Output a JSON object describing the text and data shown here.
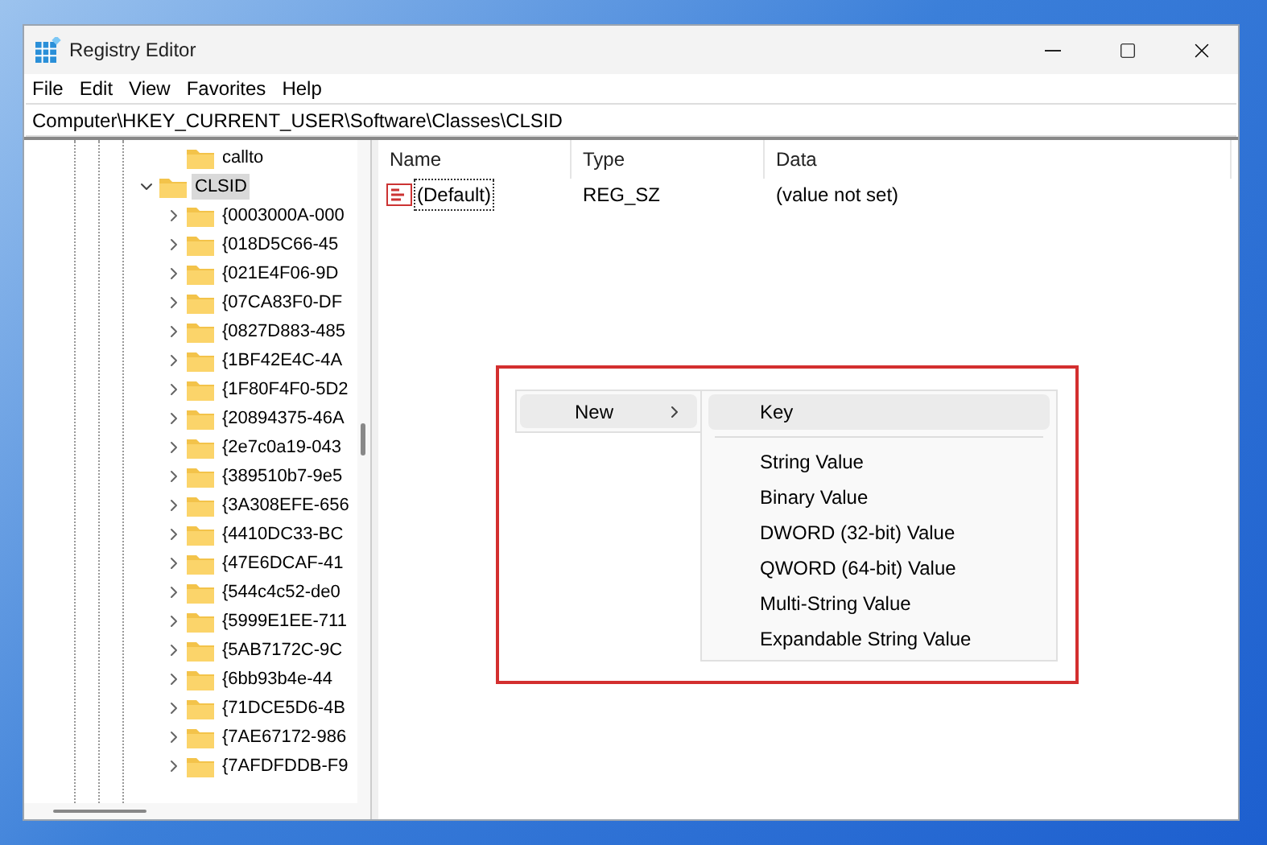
{
  "window": {
    "title": "Registry Editor"
  },
  "menu_bar": [
    "File",
    "Edit",
    "View",
    "Favorites",
    "Help"
  ],
  "address_bar": {
    "value": "Computer\\HKEY_CURRENT_USER\\Software\\Classes\\CLSID"
  },
  "tree": [
    {
      "label": "callto",
      "selected": false
    },
    {
      "label": "CLSID",
      "selected": true,
      "expanded": true,
      "children": [
        {
          "label": "{0003000A-000",
          "selected": false,
          "expanded": false
        },
        {
          "label": "{018D5C66-45",
          "selected": false,
          "expanded": false
        },
        {
          "label": "{021E4F06-9D",
          "selected": false,
          "expanded": false
        },
        {
          "label": "{07CA83F0-DF",
          "selected": false,
          "expanded": false
        },
        {
          "label": "{0827D883-485",
          "selected": false,
          "expanded": false
        },
        {
          "label": "{1BF42E4C-4A",
          "selected": false,
          "expanded": false
        },
        {
          "label": "{1F80F4F0-5D2",
          "selected": false,
          "expanded": false
        },
        {
          "label": "{20894375-46A",
          "selected": false,
          "expanded": false
        },
        {
          "label": "{2e7c0a19-043",
          "selected": false,
          "expanded": false
        },
        {
          "label": "{389510b7-9e5",
          "selected": false,
          "expanded": false
        },
        {
          "label": "{3A308EFE-656",
          "selected": false,
          "expanded": false
        },
        {
          "label": "{4410DC33-BC",
          "selected": false,
          "expanded": false
        },
        {
          "label": "{47E6DCAF-41",
          "selected": false,
          "expanded": false
        },
        {
          "label": "{544c4c52-de0",
          "selected": false,
          "expanded": false
        },
        {
          "label": "{5999E1EE-711",
          "selected": false,
          "expanded": false
        },
        {
          "label": "{5AB7172C-9C",
          "selected": false,
          "expanded": false
        },
        {
          "label": "{6bb93b4e-44",
          "selected": false,
          "expanded": false
        },
        {
          "label": "{71DCE5D6-4B",
          "selected": false,
          "expanded": false
        },
        {
          "label": "{7AE67172-986",
          "selected": false,
          "expanded": false
        },
        {
          "label": "{7AFDFDDB-F9",
          "selected": false,
          "expanded": false
        }
      ]
    }
  ],
  "values_table": {
    "columns": [
      "Name",
      "Type",
      "Data"
    ],
    "rows": [
      {
        "name": "(Default)",
        "type": "REG_SZ",
        "data": "(value not set)",
        "selected": true
      }
    ]
  },
  "context_menu": {
    "items": [
      {
        "label": "New",
        "selected": true
      }
    ],
    "submenu": [
      {
        "label": "Key",
        "selected": true,
        "kind": "item"
      },
      {
        "kind": "separator"
      },
      {
        "label": "String Value",
        "selected": false,
        "kind": "item"
      },
      {
        "label": "Binary Value",
        "selected": false,
        "kind": "item"
      },
      {
        "label": "DWORD (32-bit) Value",
        "selected": false,
        "kind": "item"
      },
      {
        "label": "QWORD (64-bit) Value",
        "selected": false,
        "kind": "item"
      },
      {
        "label": "Multi-String Value",
        "selected": false,
        "kind": "item"
      },
      {
        "label": "Expandable String Value",
        "selected": false,
        "kind": "item"
      }
    ]
  }
}
